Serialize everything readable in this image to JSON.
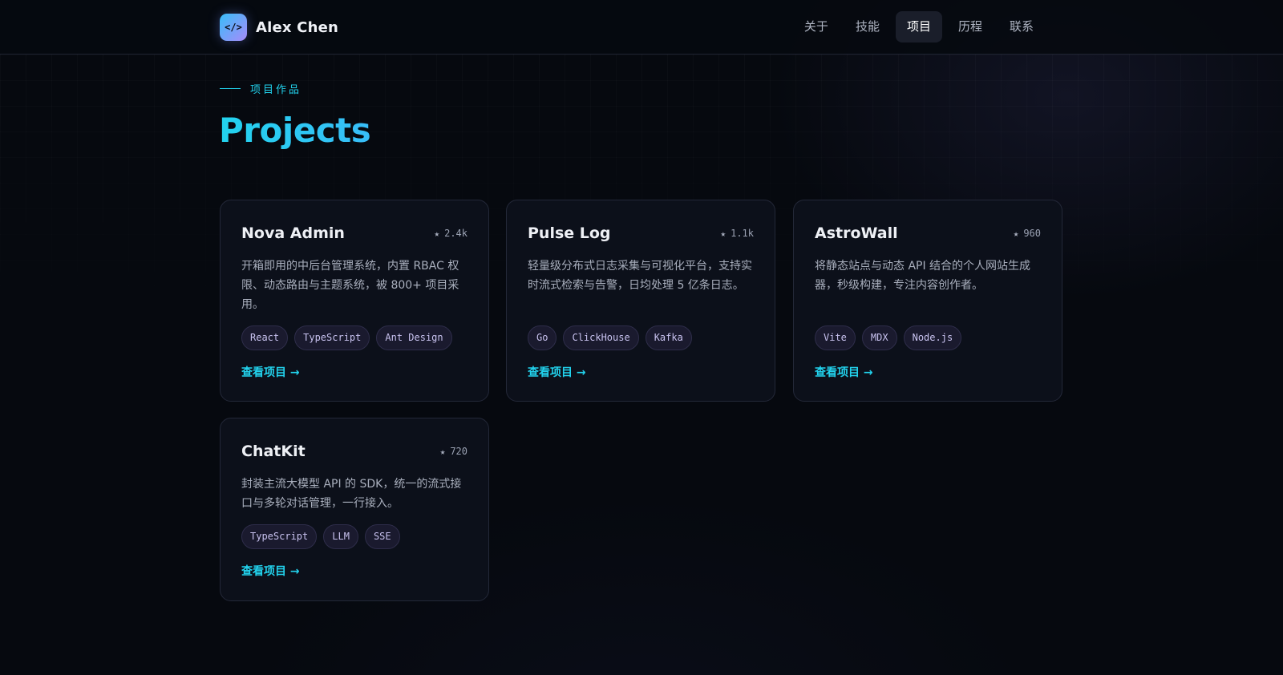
{
  "header": {
    "logo_glyph": "</>",
    "brand_name": "Alex Chen",
    "nav": [
      {
        "label": "关于",
        "active": false
      },
      {
        "label": "技能",
        "active": false
      },
      {
        "label": "项目",
        "active": true
      },
      {
        "label": "历程",
        "active": false
      },
      {
        "label": "联系",
        "active": false
      }
    ]
  },
  "section": {
    "eyebrow": "项目作品",
    "title": "Projects"
  },
  "projects": [
    {
      "title": "Nova Admin",
      "stars": "2.4k",
      "description": "开箱即用的中后台管理系统，内置 RBAC 权限、动态路由与主题系统，被 800+ 项目采用。",
      "tags": [
        "React",
        "TypeScript",
        "Ant Design"
      ],
      "link": "查看项目 →"
    },
    {
      "title": "Pulse Log",
      "stars": "1.1k",
      "description": "轻量级分布式日志采集与可视化平台，支持实时流式检索与告警，日均处理 5 亿条日志。",
      "tags": [
        "Go",
        "ClickHouse",
        "Kafka"
      ],
      "link": "查看项目 →"
    },
    {
      "title": "AstroWall",
      "stars": "960",
      "description": "将静态站点与动态 API 结合的个人网站生成器，秒级构建，专注内容创作者。",
      "tags": [
        "Vite",
        "MDX",
        "Node.js"
      ],
      "link": "查看项目 →"
    },
    {
      "title": "ChatKit",
      "stars": "720",
      "description": "封装主流大模型 API 的 SDK，统一的流式接口与多轮对话管理，一行接入。",
      "tags": [
        "TypeScript",
        "LLM",
        "SSE"
      ],
      "link": "查看项目 →"
    }
  ],
  "icons": {
    "star": "star-icon",
    "accent_color": "#22d3ee"
  }
}
